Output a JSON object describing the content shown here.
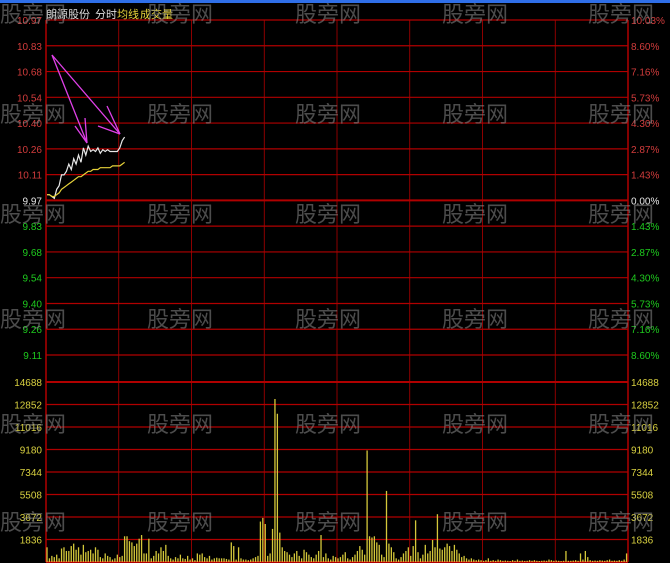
{
  "header": {
    "stock_name": "朗源股份",
    "mode": "分时",
    "avg_line": "均线",
    "volume": "成交量"
  },
  "colors": {
    "grid": "#b00000",
    "up": "#d23c3c",
    "down": "#1ecb1e",
    "neutral": "#e6e6e6",
    "price_line": "#e8e8e8",
    "avg_line": "#e6d23a",
    "volume_bar": "#d4c83a",
    "volume_label": "#d8d040",
    "annotation": "#e040e8"
  },
  "watermark": "股旁网",
  "chart_data": {
    "type": "line",
    "title": "",
    "prev_close": 9.97,
    "price_axis": {
      "ticks": [
        10.97,
        10.83,
        10.68,
        10.54,
        10.4,
        10.26,
        10.11,
        9.97,
        9.83,
        9.68,
        9.54,
        9.4,
        9.26,
        9.11
      ],
      "labels": [
        "10.97",
        "10.83",
        "10.68",
        "10.54",
        "10.40",
        "10.26",
        "10.11",
        "9.97",
        "9.83",
        "9.68",
        "9.54",
        "9.40",
        "9.26",
        "9.11"
      ],
      "pct_labels": [
        "10.03%",
        "8.60%",
        "7.16%",
        "5.73%",
        "4.30%",
        "2.87%",
        "1.43%",
        "0.00%",
        "1.43%",
        "2.87%",
        "4.30%",
        "5.73%",
        "7.16%",
        "8.60%"
      ],
      "ylim": [
        9.11,
        10.97
      ]
    },
    "x_minutes": 240,
    "series": [
      {
        "key": "price",
        "values": [
          10.0,
          10.0,
          9.99,
          9.98,
          10.03,
          10.05,
          10.11,
          10.11,
          10.13,
          10.17,
          10.14,
          10.2,
          10.17,
          10.22,
          10.18,
          10.26,
          10.22,
          10.27,
          10.24,
          10.25,
          10.24,
          10.26,
          10.23,
          10.25,
          10.24,
          10.25,
          10.24,
          10.24,
          10.24,
          10.24,
          10.26,
          10.3,
          10.32
        ]
      },
      {
        "key": "avg",
        "values": [
          10.0,
          10.0,
          9.99,
          9.99,
          10.0,
          10.01,
          10.03,
          10.04,
          10.05,
          10.06,
          10.07,
          10.08,
          10.09,
          10.1,
          10.1,
          10.11,
          10.12,
          10.13,
          10.13,
          10.14,
          10.14,
          10.14,
          10.15,
          10.15,
          10.15,
          10.15,
          10.15,
          10.16,
          10.16,
          10.16,
          10.16,
          10.17,
          10.18
        ]
      }
    ],
    "volume_axis": {
      "ticks": [
        14688,
        12852,
        11016,
        9180,
        7344,
        5508,
        3672,
        1836
      ],
      "labels": [
        "14688",
        "12852",
        "11016",
        "9180",
        "7344",
        "5508",
        "3672",
        "1836"
      ],
      "ylim": [
        0,
        14688
      ]
    },
    "volume": [
      1200,
      300,
      500,
      400,
      600,
      300,
      1100,
      1200,
      900,
      900,
      1300,
      1500,
      1000,
      1200,
      600,
      1400,
      800,
      900,
      1000,
      700,
      1200,
      1000,
      400,
      300,
      700,
      500,
      400,
      200,
      300,
      600,
      400,
      500,
      2100,
      2100,
      1700,
      1600,
      1300,
      1500,
      1900,
      2200,
      700,
      700,
      1900,
      300,
      500,
      900,
      700,
      1200,
      900,
      1400,
      500,
      300,
      200,
      400,
      300,
      600,
      300,
      250,
      500,
      200,
      300,
      150,
      700,
      600,
      700,
      400,
      300,
      500,
      200,
      300,
      350,
      300,
      300,
      300,
      250,
      200,
      1600,
      1300,
      200,
      1200,
      300,
      200,
      200,
      150,
      200,
      300,
      400,
      500,
      3300,
      3600,
      3100,
      500,
      700,
      2700,
      13300,
      12100,
      2400,
      1200,
      900,
      800,
      600,
      400,
      700,
      900,
      500,
      300,
      1000,
      800,
      600,
      400,
      300,
      600,
      900,
      2200,
      400,
      700,
      300,
      200,
      500,
      400,
      300,
      400,
      600,
      800,
      300,
      200,
      400,
      600,
      900,
      1300,
      1000,
      600,
      9100,
      2100,
      2000,
      2100,
      1600,
      1400,
      600,
      400,
      5800,
      1500,
      1200,
      800,
      300,
      200,
      400,
      700,
      900,
      1200,
      500,
      1300,
      3400,
      800,
      300,
      600,
      1400,
      700,
      900,
      1800,
      1200,
      3900,
      1100,
      1000,
      1200,
      1500,
      1300,
      900,
      1400,
      1000,
      700,
      400,
      500,
      300,
      200,
      300,
      200,
      150,
      200,
      150,
      100,
      150,
      300,
      100,
      150,
      100,
      200,
      150,
      100,
      120,
      100,
      80,
      150,
      100,
      200,
      100,
      120,
      90,
      100,
      150,
      100,
      150,
      100,
      80,
      100,
      120,
      100,
      200,
      150,
      100,
      120,
      100,
      80,
      100,
      900,
      100,
      100,
      120,
      150,
      100,
      700,
      200,
      900,
      400,
      150,
      100,
      120,
      100,
      150,
      120,
      100,
      150,
      200,
      100,
      120,
      100,
      150,
      100,
      200,
      700
    ]
  }
}
